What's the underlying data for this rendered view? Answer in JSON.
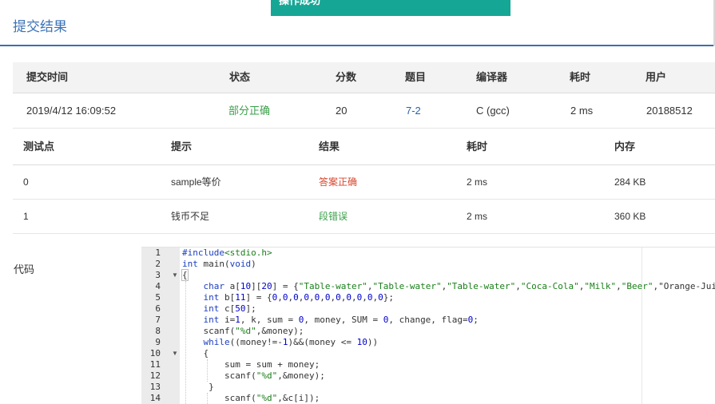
{
  "toast": "操作成功",
  "page_title": "提交结果",
  "submission": {
    "headers": [
      "提交时间",
      "状态",
      "分数",
      "题目",
      "编译器",
      "耗时",
      "用户"
    ],
    "row": {
      "time": "2019/4/12 16:09:52",
      "status": "部分正确",
      "score": "20",
      "problem": "7-2",
      "compiler": "C (gcc)",
      "elapsed": "2 ms",
      "user": "20188512"
    }
  },
  "testcases": {
    "headers": [
      "测试点",
      "提示",
      "结果",
      "耗时",
      "内存"
    ],
    "rows": [
      {
        "id": "0",
        "hint": "sample等价",
        "result": "答案正确",
        "time": "2 ms",
        "memory": "284 KB"
      },
      {
        "id": "1",
        "hint": "钱币不足",
        "result": "段错误",
        "time": "2 ms",
        "memory": "360 KB"
      }
    ]
  },
  "code_label": "代码",
  "code": {
    "line_numbers": [
      "1",
      "2",
      "3",
      "4",
      "5",
      "6",
      "7",
      "8",
      "9",
      "10",
      "11",
      "12",
      "13",
      "14"
    ],
    "lines": [
      "#include<stdio.h>",
      "int main(void)",
      "{",
      "    char a[10][20] = {\"Table-water\",\"Table-water\",\"Table-water\",\"Coca-Cola\",\"Milk\",\"Beer\",\"Orange-Juic",
      "    int b[11] = {0,0,0,0,0,0,0,0,0,0,0};",
      "    int c[50];",
      "    int i=1, k, sum = 0, money, SUM = 0, change, flag=0;",
      "    scanf(\"%d\",&money);",
      "    while((money!=-1)&&(money <= 10))",
      "    {",
      "        sum = sum + money;",
      "        scanf(\"%d\",&money);",
      "     }",
      "        scanf(\"%d\",&c[i]);"
    ]
  }
}
